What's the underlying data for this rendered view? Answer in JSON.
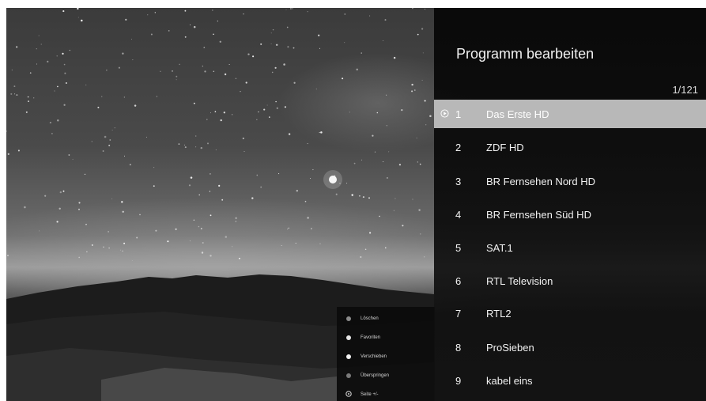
{
  "panel": {
    "title": "Programm bearbeiten",
    "page_counter": "1/121",
    "selected_index": 0,
    "channels": [
      {
        "number": "1",
        "name": "Das Erste HD"
      },
      {
        "number": "2",
        "name": "ZDF HD"
      },
      {
        "number": "3",
        "name": "BR Fernsehen Nord HD"
      },
      {
        "number": "4",
        "name": "BR Fernsehen Süd HD"
      },
      {
        "number": "5",
        "name": "SAT.1"
      },
      {
        "number": "6",
        "name": "RTL Television"
      },
      {
        "number": "7",
        "name": "RTL2"
      },
      {
        "number": "8",
        "name": "ProSieben"
      },
      {
        "number": "9",
        "name": "kabel eins"
      }
    ]
  },
  "legend": {
    "items": [
      {
        "label": "Löschen",
        "color": "#8a8a8a",
        "icon": "red-button-icon"
      },
      {
        "label": "Favoriten",
        "color": "#e6e6e6",
        "icon": "green-button-icon"
      },
      {
        "label": "Verschieben",
        "color": "#f2f2f2",
        "icon": "yellow-button-icon"
      },
      {
        "label": "Überspringen",
        "color": "#7a7a7a",
        "icon": "blue-button-icon"
      },
      {
        "label": "Seite +/-",
        "color": "#cccccc",
        "icon": "page-ring-icon"
      }
    ]
  },
  "colors": {
    "selected_row": "#b8b8b8",
    "panel_background": "#0a0a0a",
    "text": "#f2f2f2"
  }
}
